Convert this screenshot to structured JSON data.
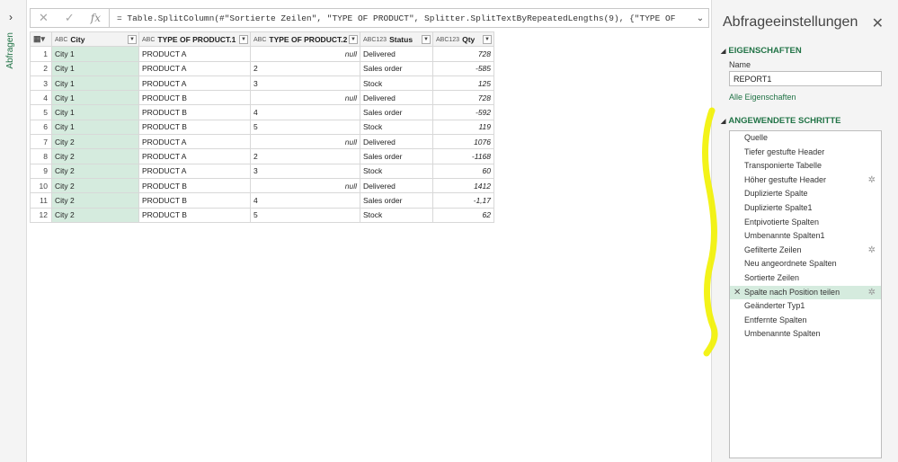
{
  "left_rail": {
    "expand_glyph": "›",
    "label": "Abfragen"
  },
  "formula_bar": {
    "cancel_glyph": "✕",
    "confirm_glyph": "✓",
    "fx_glyph": "fx",
    "text": "= Table.SplitColumn(#\"Sortierte Zeilen\", \"TYPE OF PRODUCT\", Splitter.SplitTextByRepeatedLengths(9), {\"TYPE OF",
    "expand_glyph": "⌄"
  },
  "table": {
    "columns": [
      {
        "type": "ABC",
        "name": "City"
      },
      {
        "type": "ABC",
        "name": "TYPE OF PRODUCT.1"
      },
      {
        "type": "ABC",
        "name": "TYPE OF PRODUCT.2"
      },
      {
        "type": "ABC123",
        "name": "Status"
      },
      {
        "type": "ABC123",
        "name": "Qty"
      }
    ],
    "rows": [
      {
        "n": "1",
        "city": "City 1",
        "p1": "PRODUCT A",
        "p2": "null",
        "status": "Delivered",
        "qty": "728"
      },
      {
        "n": "2",
        "city": "City 1",
        "p1": "PRODUCT A",
        "p2": "2",
        "status": "Sales order",
        "qty": "-585"
      },
      {
        "n": "3",
        "city": "City 1",
        "p1": "PRODUCT A",
        "p2": "3",
        "status": "Stock",
        "qty": "125"
      },
      {
        "n": "4",
        "city": "City 1",
        "p1": "PRODUCT B",
        "p2": "null",
        "status": "Delivered",
        "qty": "728"
      },
      {
        "n": "5",
        "city": "City 1",
        "p1": "PRODUCT B",
        "p2": "4",
        "status": "Sales order",
        "qty": "-592"
      },
      {
        "n": "6",
        "city": "City 1",
        "p1": "PRODUCT B",
        "p2": "5",
        "status": "Stock",
        "qty": "119"
      },
      {
        "n": "7",
        "city": "City 2",
        "p1": "PRODUCT A",
        "p2": "null",
        "status": "Delivered",
        "qty": "1076"
      },
      {
        "n": "8",
        "city": "City 2",
        "p1": "PRODUCT A",
        "p2": "2",
        "status": "Sales order",
        "qty": "-1168"
      },
      {
        "n": "9",
        "city": "City 2",
        "p1": "PRODUCT A",
        "p2": "3",
        "status": "Stock",
        "qty": "60"
      },
      {
        "n": "10",
        "city": "City 2",
        "p1": "PRODUCT B",
        "p2": "null",
        "status": "Delivered",
        "qty": "1412"
      },
      {
        "n": "11",
        "city": "City 2",
        "p1": "PRODUCT B",
        "p2": "4",
        "status": "Sales order",
        "qty": "-1,17"
      },
      {
        "n": "12",
        "city": "City 2",
        "p1": "PRODUCT B",
        "p2": "5",
        "status": "Stock",
        "qty": "62"
      }
    ]
  },
  "panel": {
    "title": "Abfrageeinstellungen",
    "close_glyph": "✕",
    "properties_heading": "EIGENSCHAFTEN",
    "name_label": "Name",
    "name_value": "REPORT1",
    "all_properties_link": "Alle Eigenschaften",
    "steps_heading": "ANGEWENDETE SCHRITTE",
    "steps": [
      {
        "label": "Quelle",
        "gear": false,
        "active": false
      },
      {
        "label": "Tiefer gestufte Header",
        "gear": false,
        "active": false
      },
      {
        "label": "Transponierte Tabelle",
        "gear": false,
        "active": false
      },
      {
        "label": "Höher gestufte Header",
        "gear": true,
        "active": false
      },
      {
        "label": "Duplizierte Spalte",
        "gear": false,
        "active": false
      },
      {
        "label": "Duplizierte Spalte1",
        "gear": false,
        "active": false
      },
      {
        "label": "Entpivotierte Spalten",
        "gear": false,
        "active": false
      },
      {
        "label": "Umbenannte Spalten1",
        "gear": false,
        "active": false
      },
      {
        "label": "Gefilterte Zeilen",
        "gear": true,
        "active": false
      },
      {
        "label": "Neu angeordnete Spalten",
        "gear": false,
        "active": false
      },
      {
        "label": "Sortierte Zeilen",
        "gear": false,
        "active": false
      },
      {
        "label": "Spalte nach Position teilen",
        "gear": true,
        "active": true
      },
      {
        "label": "Geänderter Typ1",
        "gear": false,
        "active": false
      },
      {
        "label": "Entfernte Spalten",
        "gear": false,
        "active": false
      },
      {
        "label": "Umbenannte Spalten",
        "gear": false,
        "active": false
      }
    ]
  },
  "colors": {
    "accent": "#217346",
    "selected_row": "#d5ebde",
    "highlighter": "#f2f200"
  }
}
